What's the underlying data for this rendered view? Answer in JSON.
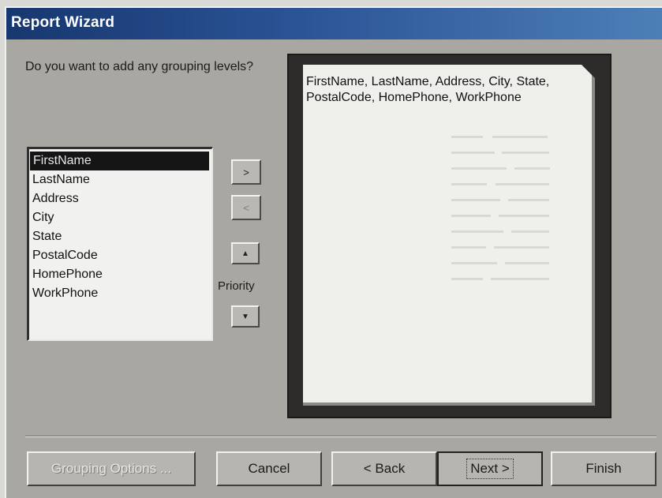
{
  "window": {
    "title": "Report Wizard"
  },
  "prompt": {
    "question": "Do you want to add any grouping levels?"
  },
  "fields": {
    "items": [
      "FirstName",
      "LastName",
      "Address",
      "City",
      "State",
      "PostalCode",
      "HomePhone",
      "WorkPhone"
    ],
    "selected": "FirstName"
  },
  "move_buttons": {
    "add_label": ">",
    "remove_label": "<",
    "priority_up": "▲",
    "priority_down": "▼",
    "priority_label": "Priority"
  },
  "preview": {
    "text": "FirstName, LastName, Address, City, State, PostalCode, HomePhone, WorkPhone"
  },
  "footer": {
    "grouping_options_label": "Grouping Options ...",
    "cancel_label": "Cancel",
    "back_label": "< Back",
    "next_label": "Next >",
    "finish_label": "Finish"
  },
  "colors": {
    "titlebar_start": "#17376f",
    "titlebar_end": "#4d7fb7",
    "dialog_face": "#a8a7a1",
    "selection": "#151515"
  }
}
